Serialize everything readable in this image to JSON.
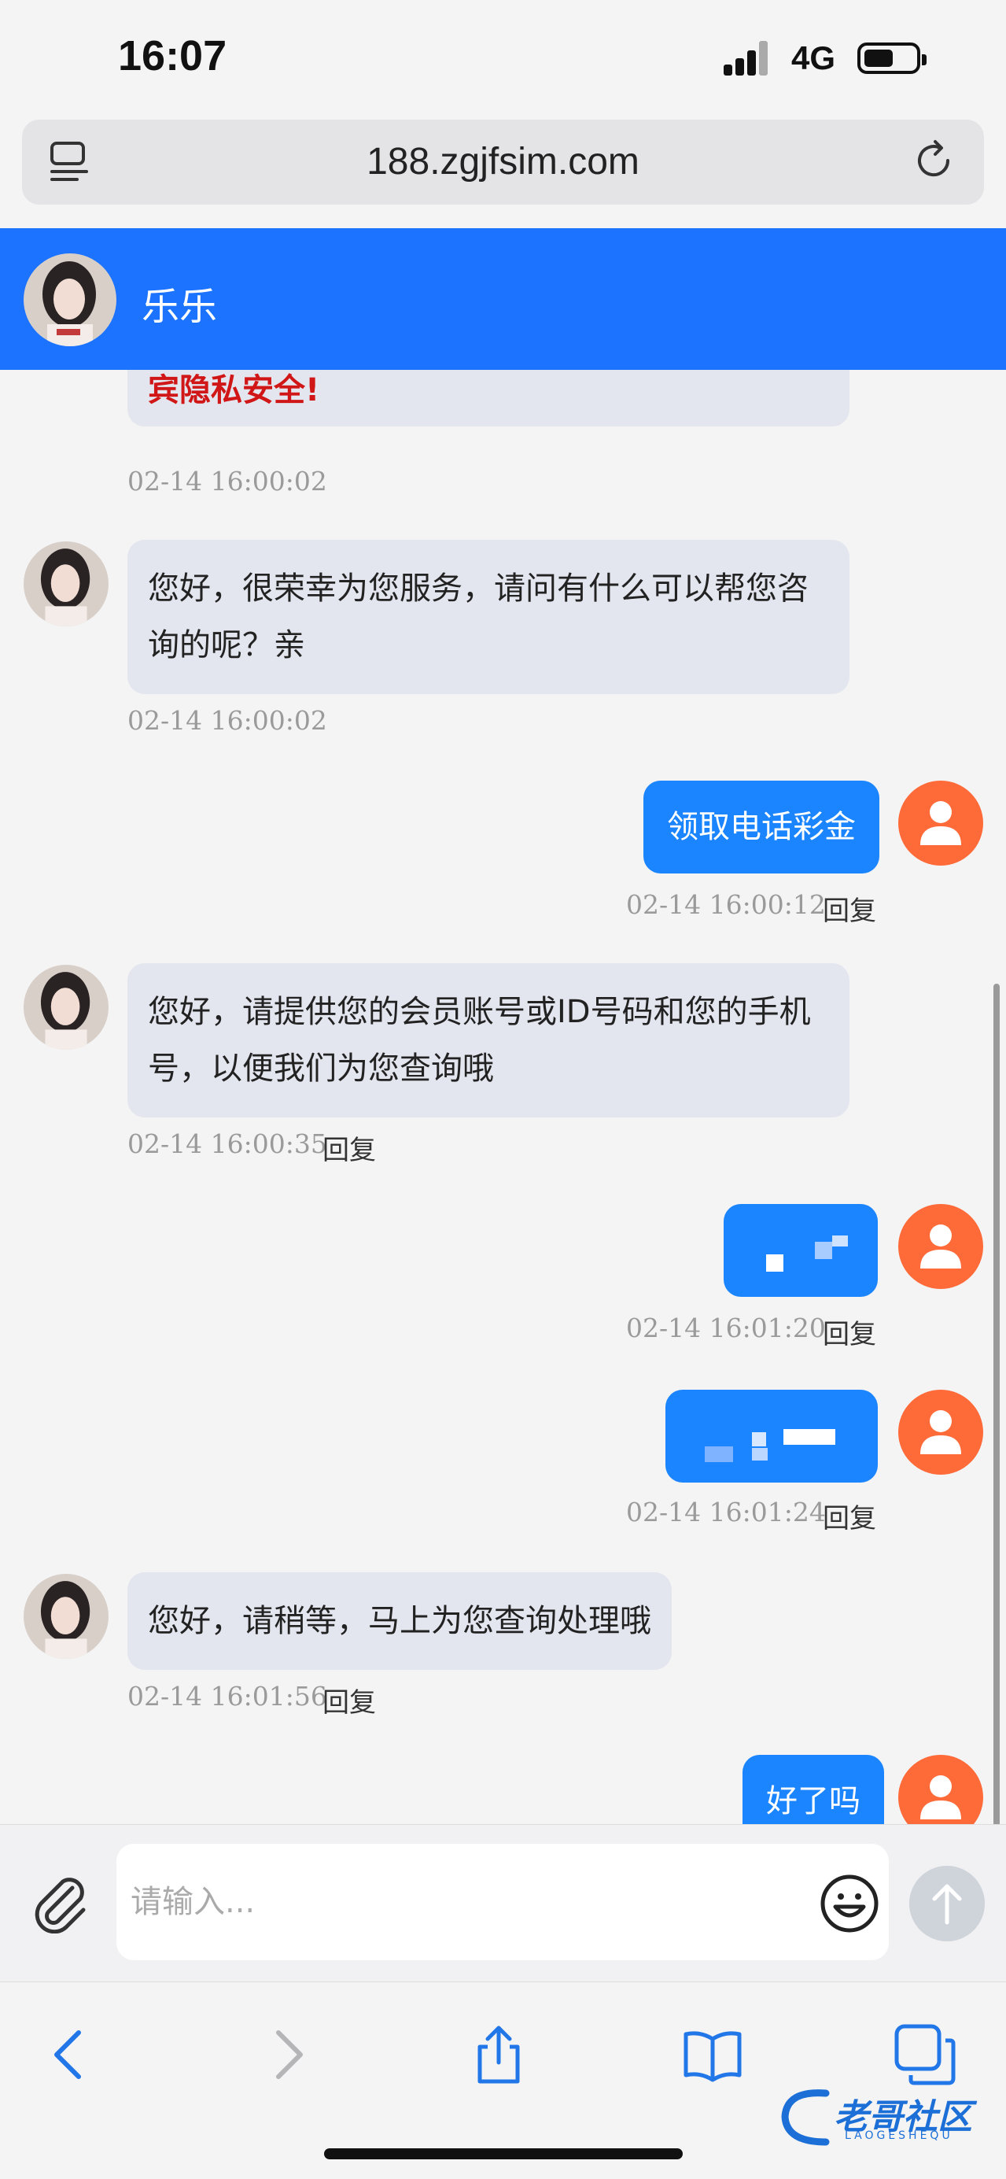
{
  "status_bar": {
    "time": "16:07",
    "network": "4G"
  },
  "browser": {
    "url": "188.zgjfsim.com"
  },
  "chat": {
    "agent_name": "乐乐",
    "input_placeholder": "请输入...",
    "reply_label": "回复",
    "messages": [
      {
        "from": "agent",
        "text": "宾隐私安全!",
        "time": "02-14 16:00:02"
      },
      {
        "from": "agent",
        "text": "您好，很荣幸为您服务，请问有什么可以帮您咨询的呢？亲",
        "time": "02-14 16:00:02"
      },
      {
        "from": "user",
        "text": "领取电话彩金",
        "time": "02-14 16:00:12"
      },
      {
        "from": "agent",
        "text": "您好，请提供您的会员账号或ID号码和您的手机号，以便我们为您查询哦",
        "time": "02-14 16:00:35"
      },
      {
        "from": "user",
        "text": "",
        "time": "02-14 16:01:20"
      },
      {
        "from": "user",
        "text": "",
        "time": "02-14 16:01:24"
      },
      {
        "from": "agent",
        "text": "您好，请稍等，马上为您查询处理哦",
        "time": "02-14 16:01:56"
      },
      {
        "from": "user",
        "text": "好了吗",
        "time": ""
      }
    ]
  },
  "watermark": {
    "text": "老哥社区",
    "sub": "LAOGESHEQU"
  },
  "colors": {
    "header": "#1b73ff",
    "user_bubble": "#1b84ff",
    "user_avatar": "#ff6a39",
    "warn": "#d01616"
  }
}
